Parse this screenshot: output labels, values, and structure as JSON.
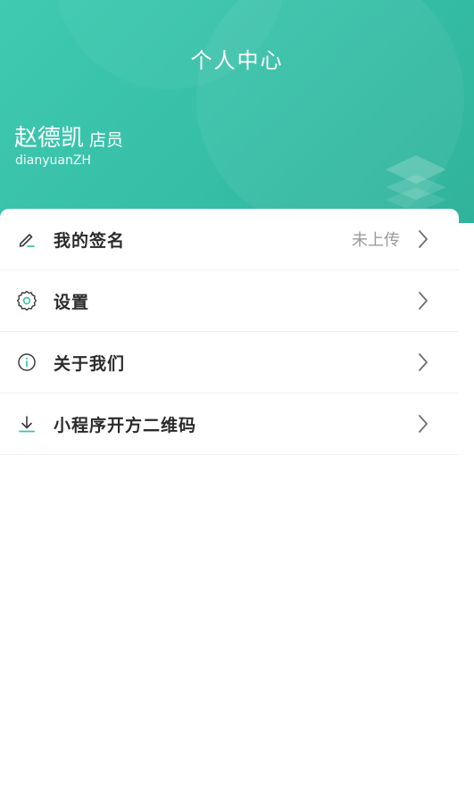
{
  "header": {
    "title": "个人中心",
    "user_name": "赵德凯",
    "user_role": "店员",
    "user_account": "dianyuanZH",
    "bg_color": "#3cc4ac"
  },
  "menu": {
    "items": [
      {
        "label": "我的签名",
        "value": "未上传",
        "icon": "pen-icon"
      },
      {
        "label": "设置",
        "value": "",
        "icon": "gear-icon"
      },
      {
        "label": "关于我们",
        "value": "",
        "icon": "info-icon"
      },
      {
        "label": "小程序开方二维码",
        "value": "",
        "icon": "download-icon"
      }
    ]
  },
  "colors": {
    "accent": "#3cc4ac",
    "text": "#2b2b2b",
    "muted": "#9a9a9a"
  }
}
